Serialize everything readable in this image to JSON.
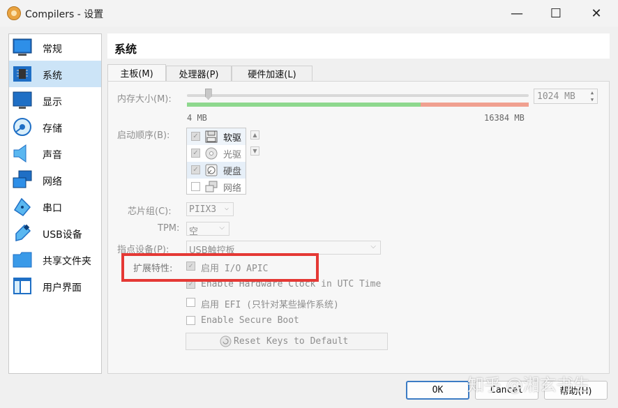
{
  "window": {
    "title": "Compilers - 设置",
    "minimize": "—",
    "maximize": "☐",
    "close": "✕"
  },
  "sidebar": {
    "items": [
      {
        "label": "常规",
        "icon": "general-settings-icon"
      },
      {
        "label": "系统",
        "icon": "system-chip-icon"
      },
      {
        "label": "显示",
        "icon": "display-monitor-icon"
      },
      {
        "label": "存储",
        "icon": "storage-disk-icon"
      },
      {
        "label": "声音",
        "icon": "speaker-icon"
      },
      {
        "label": "网络",
        "icon": "network-icon"
      },
      {
        "label": "串口",
        "icon": "serial-port-icon"
      },
      {
        "label": "USB设备",
        "icon": "usb-icon"
      },
      {
        "label": "共享文件夹",
        "icon": "shared-folder-icon"
      },
      {
        "label": "用户界面",
        "icon": "user-interface-icon"
      }
    ],
    "selected_index": 1
  },
  "section_title": "系统",
  "tabs": [
    {
      "label": "主板(M)"
    },
    {
      "label": "处理器(P)"
    },
    {
      "label": "硬件加速(L)"
    }
  ],
  "motherboard": {
    "memory_label": "内存大小(M):",
    "memory_value": "1024 MB",
    "memory_min": "4 MB",
    "memory_max": "16384 MB",
    "memory_fraction": 0.0625,
    "boot_order_label": "启动顺序(B):",
    "boot_items": [
      {
        "label": "软驱",
        "checked": true,
        "icon": "floppy-icon"
      },
      {
        "label": "光驱",
        "checked": true,
        "icon": "optical-disc-icon"
      },
      {
        "label": "硬盘",
        "checked": true,
        "icon": "hard-disk-icon"
      },
      {
        "label": "网络",
        "checked": false,
        "icon": "network-boot-icon"
      }
    ],
    "move_up": "▲",
    "move_down": "▼",
    "chipset_label": "芯片组(C):",
    "chipset_value": "PIIX3",
    "tpm_label": "TPM:",
    "tpm_value": "空",
    "pointing_label": "指点设备(P):",
    "pointing_value": "USB触控板",
    "ext_label": "扩展特性:",
    "ext_options": [
      {
        "label": "启用 I/O APIC",
        "checked": true
      },
      {
        "label": "Enable Hardware Clock in UTC Time",
        "checked": true
      },
      {
        "label": "启用 EFI (只针对某些操作系统)",
        "checked": false
      },
      {
        "label": "Enable Secure Boot",
        "checked": false
      }
    ],
    "reset_keys": "Reset Keys to Default"
  },
  "buttons": {
    "ok": "OK",
    "cancel": "Cancel",
    "help": "帮助(H)"
  },
  "watermark": "知乎 @湘玄书生",
  "colors": {
    "highlight": "#e53935",
    "selected": "#cce4f7",
    "slider_green": "#8ed88e",
    "slider_red": "#f0a090"
  }
}
